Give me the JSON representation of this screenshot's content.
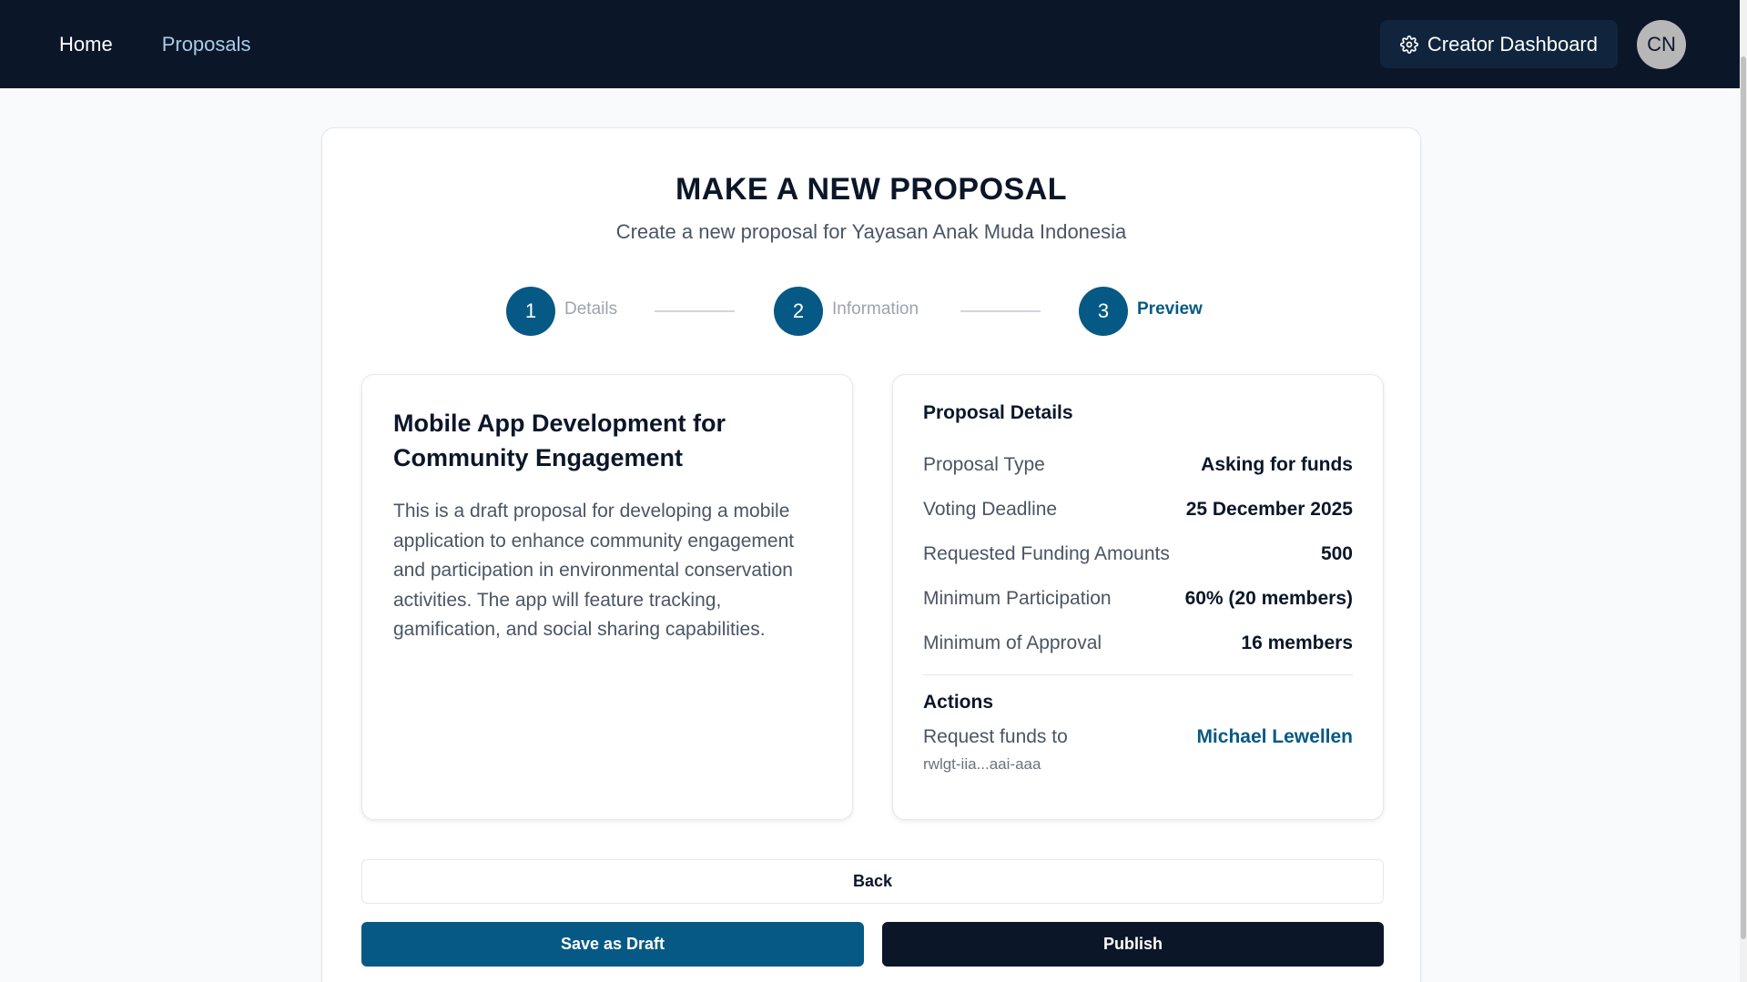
{
  "navbar": {
    "links": [
      "Home",
      "Proposals"
    ],
    "creator_dashboard": "Creator Dashboard",
    "avatar_initials": "CN"
  },
  "page": {
    "title": "MAKE A NEW PROPOSAL",
    "subtitle": "Create a new proposal for Yayasan Anak Muda Indonesia"
  },
  "stepper": {
    "steps": [
      {
        "number": "1",
        "label": "Details"
      },
      {
        "number": "2",
        "label": "Information"
      },
      {
        "number": "3",
        "label": "Preview"
      }
    ],
    "current_step": 3
  },
  "proposal": {
    "title": "Mobile App Development for Community Engagement",
    "description": "This is a draft proposal for developing a mobile application to enhance community engagement and participation in environmental conservation activities. The app will feature tracking, gamification, and social sharing capabilities."
  },
  "details": {
    "heading": "Proposal Details",
    "rows": [
      {
        "label": "Proposal Type",
        "value": "Asking for funds"
      },
      {
        "label": "Voting Deadline",
        "value": "25 December 2025"
      },
      {
        "label": "Requested Funding Amounts",
        "value": "500"
      },
      {
        "label": "Minimum Participation",
        "value": "60% (20 members)"
      },
      {
        "label": "Minimum of Approval",
        "value": "16 members"
      }
    ],
    "actions_heading": "Actions",
    "action": {
      "label": "Request funds to",
      "sub": "rwlgt-iia...aai-aaa",
      "recipient": "Michael Lewellen"
    }
  },
  "buttons": {
    "back": "Back",
    "save_draft": "Save as Draft",
    "publish": "Publish"
  },
  "colors": {
    "navbar_bg": "#0b1629",
    "accent": "#075985",
    "primary_dark": "#0b1629"
  },
  "icons": {
    "creator_dashboard": "gear-icon"
  }
}
